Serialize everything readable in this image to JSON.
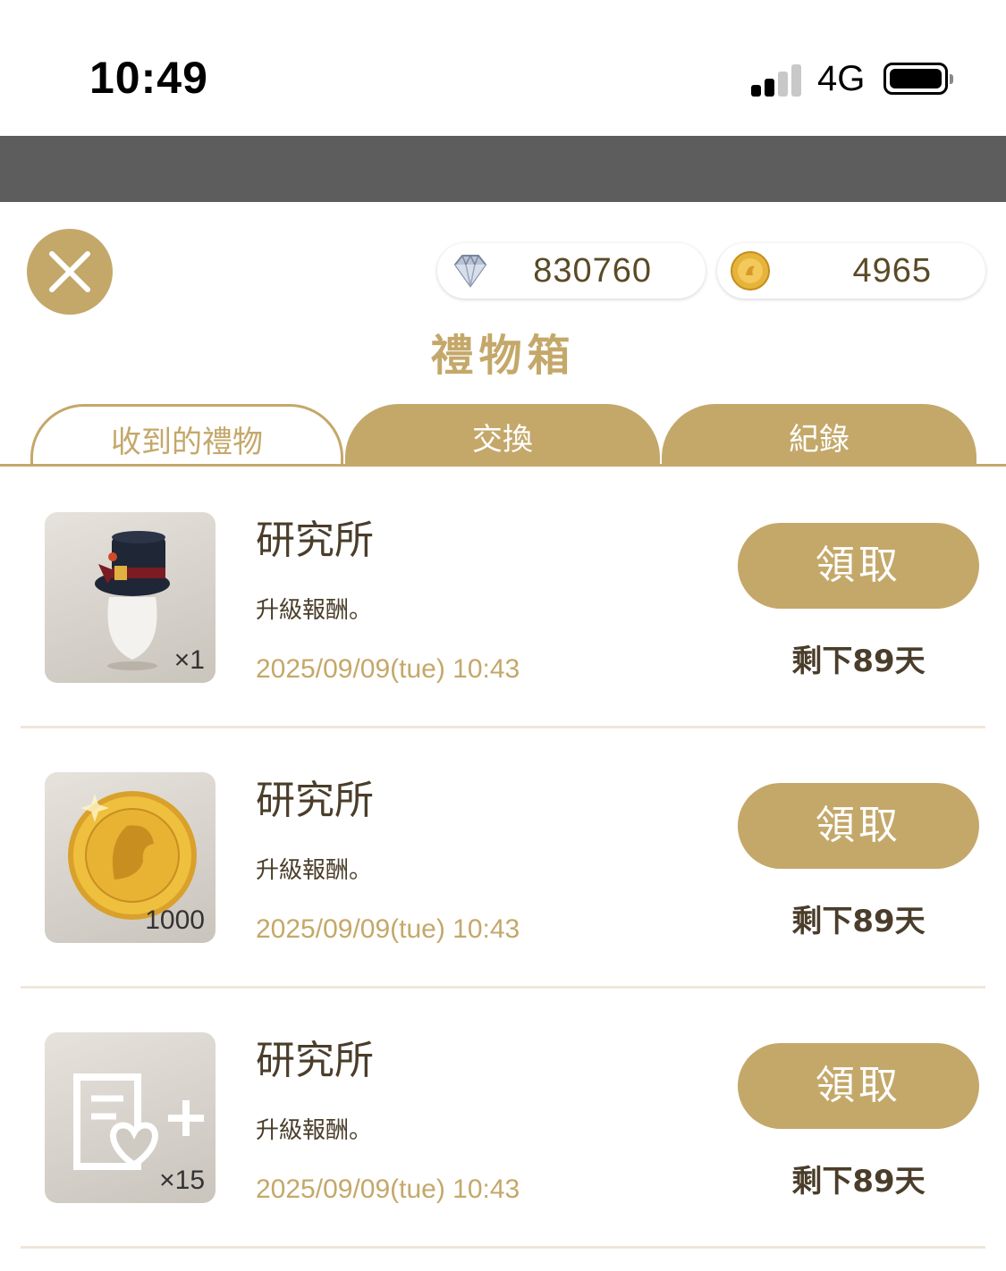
{
  "status_bar": {
    "time": "10:49",
    "network": "4G"
  },
  "header": {
    "diamond_count": "830760",
    "coin_count": "4965",
    "title": "禮物箱"
  },
  "tabs": [
    {
      "label": "收到的禮物",
      "active": true
    },
    {
      "label": "交換",
      "active": false
    },
    {
      "label": "紀錄",
      "active": false
    }
  ],
  "gifts": [
    {
      "icon": "top-hat-icon",
      "quantity": "×1",
      "title": "研究所",
      "description": "升級報酬。",
      "date": "2025/09/09(tue) 10:43",
      "button": "領取",
      "remaining": "剩下89天"
    },
    {
      "icon": "gold-coin-icon",
      "quantity": "1000",
      "title": "研究所",
      "description": "升級報酬。",
      "date": "2025/09/09(tue) 10:43",
      "button": "領取",
      "remaining": "剩下89天"
    },
    {
      "icon": "heart-document-plus-icon",
      "quantity": "×15",
      "title": "研究所",
      "description": "升級報酬。",
      "date": "2025/09/09(tue) 10:43",
      "button": "領取",
      "remaining": "剩下89天"
    }
  ],
  "colors": {
    "accent": "#c4a86a",
    "text": "#4a3d2a",
    "band": "#5d5d5d"
  }
}
